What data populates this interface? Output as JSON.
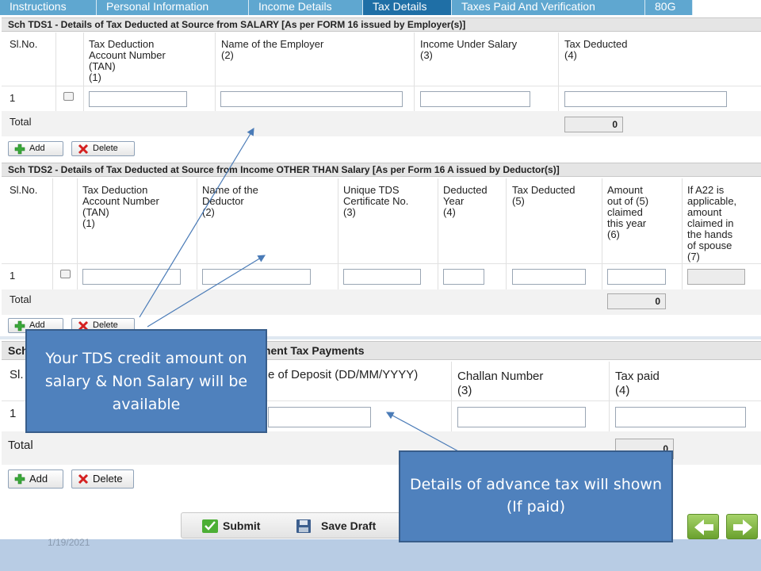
{
  "tabs": [
    "Instructions",
    "Personal Information",
    "Income Details",
    "Tax Details",
    "Taxes Paid And Verification",
    "80G"
  ],
  "active_tab": "Tax Details",
  "tds1": {
    "title": "Sch TDS1 - Details of Tax Deducted at Source from SALARY [As per FORM 16 issued by Employer(s)]",
    "cols": {
      "slno": "Sl.No.",
      "tan": "Tax Deduction\nAccount Number\n(TAN)\n(1)",
      "employer": "Name of the Employer\n(2)",
      "income": "Income Under Salary\n(3)",
      "deducted": "Tax Deducted\n(4)"
    },
    "row_no": "1",
    "total_label": "Total",
    "total_value": "0"
  },
  "tds2": {
    "title": "Sch TDS2 - Details of Tax Deducted at Source from Income OTHER THAN Salary [As per Form 16 A issued by Deductor(s)]",
    "cols": {
      "slno": "Sl.No.",
      "tan": "Tax Deduction\nAccount Number\n(TAN)\n(1)",
      "deductor": "Name of the\nDeductor\n(2)",
      "cert": "Unique TDS\nCertificate No.\n(3)",
      "year": "Deducted\nYear\n(4)",
      "deducted": "Tax Deducted\n(5)",
      "claimed": "Amount\nout of (5)\nclaimed\nthis year\n(6)",
      "spouse": "If A22 is\napplicable,\namount\nclaimed in\nthe hands\nof spouse\n(7)"
    },
    "row_no": "1",
    "total_label": "Total",
    "total_value": "0"
  },
  "it": {
    "title_visible": "essment Tax Payments",
    "slno_partial": "Sl.",
    "date_partial": "e of Deposit (DD/MM/YYYY)",
    "challan": "Challan Number\n(3)",
    "taxpaid": "Tax paid\n(4)",
    "row_no": "1",
    "total_label": "Total",
    "total_value": "0",
    "sch_partial": "Sch"
  },
  "buttons": {
    "add": "Add",
    "delete": "Delete",
    "submit": "Submit",
    "save_draft": "Save Draft"
  },
  "callouts": {
    "tds": "Your  TDS credit amount on salary & Non Salary will be available",
    "advance": "Details of advance tax will shown (If paid)"
  },
  "footer_date": "1/19/2021",
  "colors": {
    "tab": "#5fa7d0",
    "tab_active": "#1f6fa6",
    "callout": "#4f81bd",
    "add_icon": "#3aa83a",
    "delete_icon": "#d42020"
  }
}
